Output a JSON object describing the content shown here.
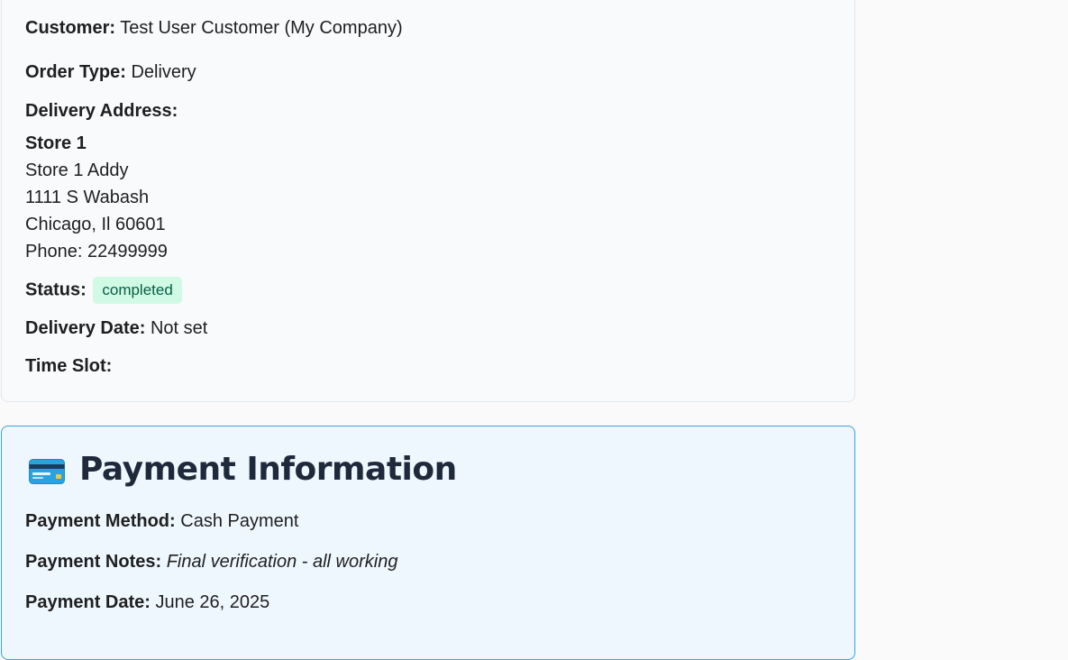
{
  "order": {
    "customer_label": "Customer:",
    "customer_value": "Test User Customer (My Company)",
    "order_type_label": "Order Type:",
    "order_type_value": "Delivery",
    "delivery_address_label": "Delivery Address:",
    "address": {
      "name": "Store 1",
      "line1": "Store 1 Addy",
      "line2": "1111 S Wabash",
      "line3": "Chicago, Il 60601",
      "phone": "Phone: 22499999"
    },
    "status_label": "Status:",
    "status_value": "completed",
    "delivery_date_label": "Delivery Date:",
    "delivery_date_value": "Not set",
    "time_slot_label": "Time Slot:"
  },
  "payment": {
    "icon": "credit-card-icon",
    "title": "Payment Information",
    "method_label": "Payment Method:",
    "method_value": "Cash Payment",
    "notes_label": "Payment Notes:",
    "notes_value": "Final verification - all working",
    "date_label": "Payment Date:",
    "date_value": "June 26, 2025"
  },
  "colors": {
    "status_badge_bg": "#d1fae5",
    "status_badge_text": "#065f46",
    "payment_border": "#3aa0d8",
    "payment_bg": "#eff7fe"
  }
}
